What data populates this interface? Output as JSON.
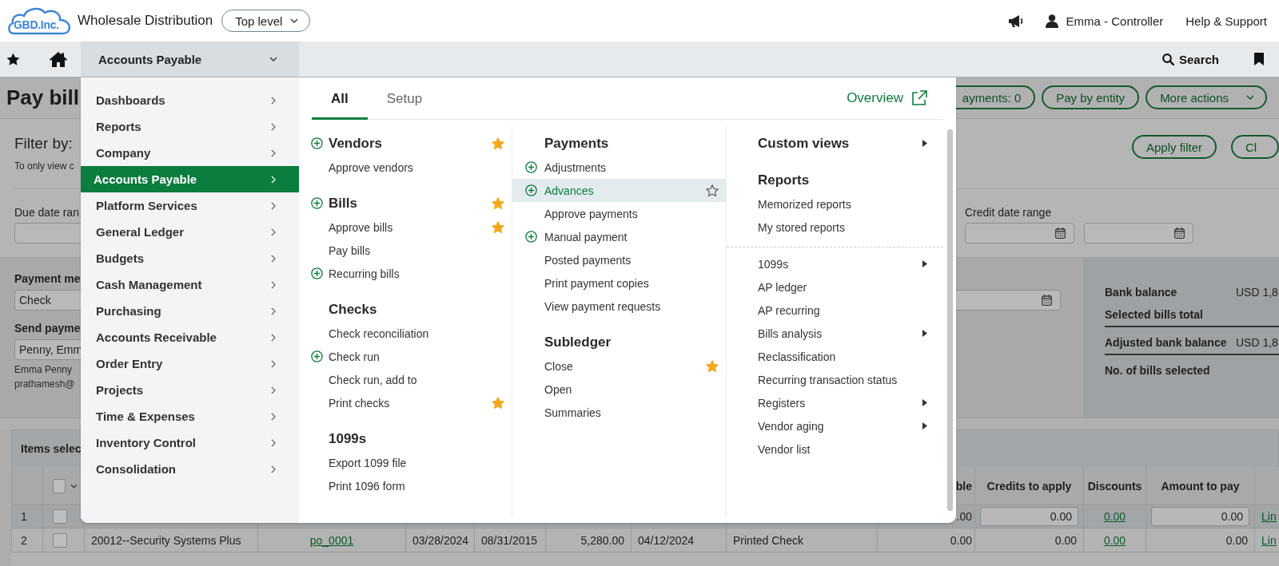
{
  "header": {
    "logo": "GBD.Inc.",
    "company": "Wholesale Distribution",
    "entity_selector": "Top level",
    "user": "Emma - Controller",
    "help": "Help & Support"
  },
  "nav": {
    "module": "Accounts Payable",
    "search": "Search"
  },
  "page": {
    "title": "Pay bill",
    "action_buttons": [
      {
        "label": "ayments: 0",
        "kind": "button"
      },
      {
        "label": "Pay by entity",
        "kind": "button"
      },
      {
        "label": "More actions",
        "kind": "dropdown"
      }
    ],
    "filter": {
      "label": "Filter by:",
      "hint": "To only view c",
      "due_date_label": "Due date ran",
      "apply": "Apply filter",
      "clear": "Cl",
      "credit_date_label": "Credit date range"
    },
    "payment": {
      "method_label": "Payment me",
      "method": "Check",
      "send_label": "Send payme",
      "send_to": "Penny, Emm",
      "contact_name": "Emma Penny",
      "contact_email": "prathamesh@"
    },
    "summary": [
      {
        "label": "Bank balance",
        "value": "USD 1,8",
        "underlined": false
      },
      {
        "label": "Selected bills total",
        "underlined": true
      },
      {
        "label": "Adjusted bank balance",
        "value": "USD 1,8",
        "underlined": true
      },
      {
        "label": "No. of bills selected",
        "underlined": false
      }
    ],
    "table": {
      "title": "Items selec",
      "select_all_checked": false,
      "columns": [
        "",
        "",
        "",
        "",
        "",
        "",
        "",
        "ble",
        "Credits to apply",
        "Discounts",
        "Amount to pay"
      ],
      "rows": [
        {
          "number": "1",
          "checked": false,
          "cells": [
            {
              "kind": "text",
              "text": ""
            },
            {
              "kind": "text",
              "text": ""
            },
            {
              "kind": "text",
              "text": ""
            },
            {
              "kind": "text",
              "text": ""
            },
            {
              "kind": "text",
              "text": ""
            },
            {
              "kind": "text",
              "text": ""
            },
            {
              "kind": "text",
              "text": ""
            },
            {
              "kind": "amount",
              "text": ".00"
            },
            {
              "kind": "input",
              "text": "0.00"
            },
            {
              "kind": "link",
              "text": "0.00"
            },
            {
              "kind": "input",
              "text": "0.00"
            },
            {
              "kind": "link",
              "text": "Lin"
            }
          ]
        },
        {
          "number": "2",
          "checked": false,
          "cells": [
            {
              "kind": "text",
              "text": "20012--Security Systems Plus"
            },
            {
              "kind": "link",
              "text": "po_0001"
            },
            {
              "kind": "text",
              "text": "03/28/2024"
            },
            {
              "kind": "text",
              "text": "08/31/2015"
            },
            {
              "kind": "amount",
              "text": "5,280.00"
            },
            {
              "kind": "text",
              "text": "04/12/2024"
            },
            {
              "kind": "text",
              "text": "Printed Check"
            },
            {
              "kind": "amount",
              "text": "0.00"
            },
            {
              "kind": "amount",
              "text": "0.00"
            },
            {
              "kind": "link",
              "text": "0.00"
            },
            {
              "kind": "amount",
              "text": "0.00"
            },
            {
              "kind": "link",
              "text": "Lin"
            }
          ]
        }
      ]
    }
  },
  "menu": {
    "categories": [
      {
        "label": "Dashboards",
        "selected": false
      },
      {
        "label": "Reports",
        "selected": false
      },
      {
        "label": "Company",
        "selected": false
      },
      {
        "label": "Accounts Payable",
        "selected": true
      },
      {
        "label": "Platform Services",
        "selected": false
      },
      {
        "label": "General Ledger",
        "selected": false
      },
      {
        "label": "Budgets",
        "selected": false
      },
      {
        "label": "Cash Management",
        "selected": false
      },
      {
        "label": "Purchasing",
        "selected": false
      },
      {
        "label": "Accounts Receivable",
        "selected": false
      },
      {
        "label": "Order Entry",
        "selected": false
      },
      {
        "label": "Projects",
        "selected": false
      },
      {
        "label": "Time & Expenses",
        "selected": false
      },
      {
        "label": "Inventory Control",
        "selected": false
      },
      {
        "label": "Consolidation",
        "selected": false
      }
    ],
    "tabs": [
      {
        "label": "All",
        "selected": true
      },
      {
        "label": "Setup",
        "selected": false
      }
    ],
    "overview": "Overview",
    "columns": [
      {
        "sections": [
          {
            "separated": false,
            "heading": {
              "label": "Vendors",
              "add": true,
              "favorite": true,
              "submenu": false
            },
            "items": [
              {
                "label": "Approve vendors",
                "add": false,
                "favorite": false,
                "submenu": false,
                "highlighted": false
              }
            ]
          },
          {
            "separated": false,
            "heading": {
              "label": "Bills",
              "add": true,
              "favorite": true,
              "submenu": false
            },
            "items": [
              {
                "label": "Approve bills",
                "add": false,
                "favorite": true,
                "submenu": false,
                "highlighted": false
              },
              {
                "label": "Pay bills",
                "add": false,
                "favorite": false,
                "submenu": false,
                "highlighted": false
              },
              {
                "label": "Recurring bills",
                "add": true,
                "favorite": false,
                "submenu": false,
                "highlighted": false
              }
            ]
          },
          {
            "separated": false,
            "heading": {
              "label": "Checks",
              "add": false,
              "favorite": false,
              "submenu": false
            },
            "items": [
              {
                "label": "Check reconciliation",
                "add": false,
                "favorite": false,
                "submenu": false,
                "highlighted": false
              },
              {
                "label": "Check run",
                "add": true,
                "favorite": false,
                "submenu": false,
                "highlighted": false
              },
              {
                "label": "Check run, add to",
                "add": false,
                "favorite": false,
                "submenu": false,
                "highlighted": false
              },
              {
                "label": "Print checks",
                "add": false,
                "favorite": true,
                "submenu": false,
                "highlighted": false
              }
            ]
          },
          {
            "separated": false,
            "heading": {
              "label": "1099s",
              "add": false,
              "favorite": false,
              "submenu": false
            },
            "items": [
              {
                "label": "Export 1099 file",
                "add": false,
                "favorite": false,
                "submenu": false,
                "highlighted": false
              },
              {
                "label": "Print 1096 form",
                "add": false,
                "favorite": false,
                "submenu": false,
                "highlighted": false
              }
            ]
          }
        ]
      },
      {
        "sections": [
          {
            "separated": false,
            "heading": {
              "label": "Payments",
              "add": false,
              "favorite": false,
              "submenu": false
            },
            "items": [
              {
                "label": "Adjustments",
                "add": true,
                "favorite": false,
                "submenu": false,
                "highlighted": false
              },
              {
                "label": "Advances",
                "add": true,
                "favorite": false,
                "submenu": false,
                "highlighted": true
              },
              {
                "label": "Approve payments",
                "add": false,
                "favorite": false,
                "submenu": false,
                "highlighted": false
              },
              {
                "label": "Manual payment",
                "add": true,
                "favorite": false,
                "submenu": false,
                "highlighted": false
              },
              {
                "label": "Posted payments",
                "add": false,
                "favorite": false,
                "submenu": false,
                "highlighted": false
              },
              {
                "label": "Print payment copies",
                "add": false,
                "favorite": false,
                "submenu": false,
                "highlighted": false
              },
              {
                "label": "View payment requests",
                "add": false,
                "favorite": false,
                "submenu": false,
                "highlighted": false
              }
            ]
          },
          {
            "separated": false,
            "heading": {
              "label": "Subledger",
              "add": false,
              "favorite": false,
              "submenu": false
            },
            "items": [
              {
                "label": "Close",
                "add": false,
                "favorite": true,
                "submenu": false,
                "highlighted": false
              },
              {
                "label": "Open",
                "add": false,
                "favorite": false,
                "submenu": false,
                "highlighted": false
              },
              {
                "label": "Summaries",
                "add": false,
                "favorite": false,
                "submenu": false,
                "highlighted": false
              }
            ]
          }
        ]
      },
      {
        "sections": [
          {
            "separated": false,
            "heading": {
              "label": "Custom views",
              "add": false,
              "favorite": false,
              "submenu": true
            }
          },
          {
            "separated": false,
            "heading": {
              "label": "Reports",
              "add": false,
              "favorite": false,
              "submenu": false
            },
            "items": [
              {
                "label": "Memorized reports",
                "add": false,
                "favorite": false,
                "submenu": false,
                "highlighted": false
              },
              {
                "label": "My stored reports",
                "add": false,
                "favorite": false,
                "submenu": false,
                "highlighted": false
              }
            ]
          },
          {
            "separated": true,
            "items": [
              {
                "label": "1099s",
                "add": false,
                "favorite": false,
                "submenu": true,
                "highlighted": false
              },
              {
                "label": "AP ledger",
                "add": false,
                "favorite": false,
                "submenu": false,
                "highlighted": false
              },
              {
                "label": "AP recurring",
                "add": false,
                "favorite": false,
                "submenu": false,
                "highlighted": false
              },
              {
                "label": "Bills analysis",
                "add": false,
                "favorite": false,
                "submenu": true,
                "highlighted": false
              },
              {
                "label": "Reclassification",
                "add": false,
                "favorite": false,
                "submenu": false,
                "highlighted": false
              },
              {
                "label": "Recurring transaction status",
                "add": false,
                "favorite": false,
                "submenu": false,
                "highlighted": false
              },
              {
                "label": "Registers",
                "add": false,
                "favorite": false,
                "submenu": true,
                "highlighted": false
              },
              {
                "label": "Vendor aging",
                "add": false,
                "favorite": false,
                "submenu": true,
                "highlighted": false
              },
              {
                "label": "Vendor list",
                "add": false,
                "favorite": false,
                "submenu": false,
                "highlighted": false
              }
            ]
          }
        ]
      }
    ]
  }
}
